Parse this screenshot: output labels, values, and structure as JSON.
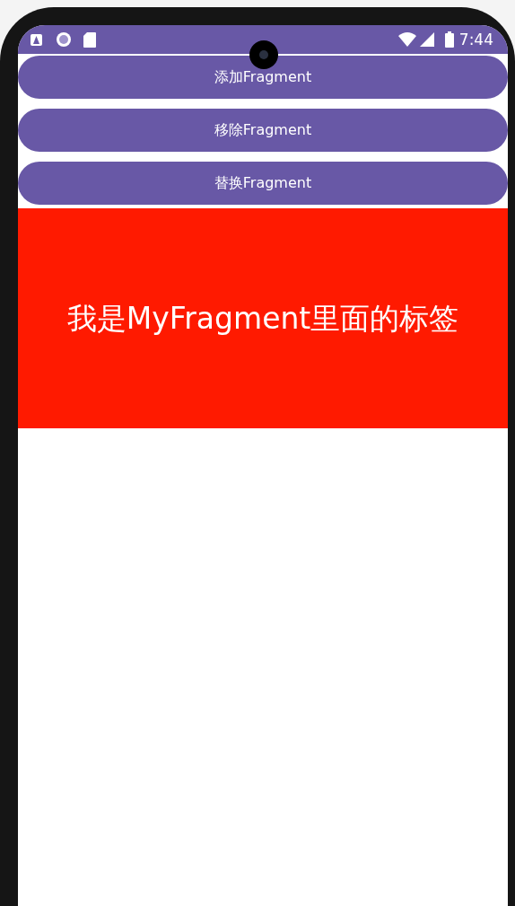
{
  "status_bar": {
    "time": "7:44"
  },
  "buttons": [
    {
      "label": "添加Fragment"
    },
    {
      "label": "移除Fragment"
    },
    {
      "label": "替换Fragment"
    }
  ],
  "fragment": {
    "label": "我是MyFragment里面的标签"
  }
}
